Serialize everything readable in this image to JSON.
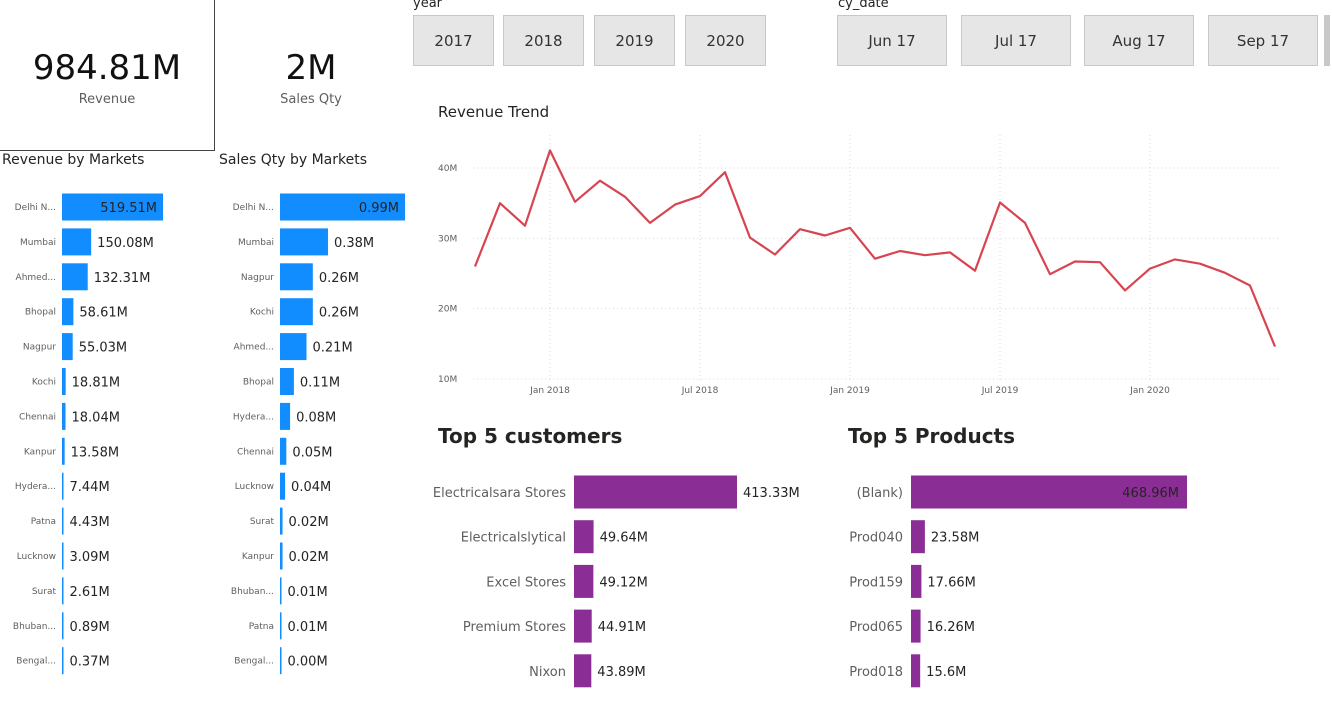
{
  "kpis": {
    "revenue": {
      "value": "984.81M",
      "label": "Revenue"
    },
    "sales_qty": {
      "value": "2M",
      "label": "Sales Qty"
    }
  },
  "slicers": {
    "year": {
      "label": "year",
      "options": [
        "2017",
        "2018",
        "2019",
        "2020"
      ]
    },
    "cy_date": {
      "label": "cy_date",
      "options": [
        "Jun 17",
        "Jul 17",
        "Aug 17",
        "Sep 17"
      ]
    }
  },
  "colors": {
    "blue_bar": "#118dff",
    "purple_bar": "#8a2e96",
    "line": "#d64550",
    "grid": "#d9d9d9"
  },
  "chart_data": [
    {
      "id": "revenue_by_markets",
      "type": "bar",
      "orientation": "horizontal",
      "title": "Revenue by Markets",
      "categories": [
        "Delhi N...",
        "Mumbai",
        "Ahmed...",
        "Bhopal",
        "Nagpur",
        "Kochi",
        "Chennai",
        "Kanpur",
        "Hydera...",
        "Patna",
        "Lucknow",
        "Surat",
        "Bhuban...",
        "Bengal..."
      ],
      "values": [
        519.51,
        150.08,
        132.31,
        58.61,
        55.03,
        18.81,
        18.04,
        13.58,
        7.44,
        4.43,
        3.09,
        2.61,
        0.89,
        0.37
      ],
      "labels": [
        "519.51M",
        "150.08M",
        "132.31M",
        "58.61M",
        "55.03M",
        "18.81M",
        "18.04M",
        "13.58M",
        "7.44M",
        "4.43M",
        "3.09M",
        "2.61M",
        "0.89M",
        "0.37M"
      ],
      "unit": "M",
      "color": "#118dff"
    },
    {
      "id": "sales_qty_by_markets",
      "type": "bar",
      "orientation": "horizontal",
      "title": "Sales Qty by Markets",
      "categories": [
        "Delhi N...",
        "Mumbai",
        "Nagpur",
        "Kochi",
        "Ahmed...",
        "Bhopal",
        "Hydera...",
        "Chennai",
        "Lucknow",
        "Surat",
        "Kanpur",
        "Bhuban...",
        "Patna",
        "Bengal..."
      ],
      "values": [
        0.99,
        0.38,
        0.26,
        0.26,
        0.21,
        0.11,
        0.08,
        0.05,
        0.04,
        0.02,
        0.02,
        0.01,
        0.01,
        0.0
      ],
      "labels": [
        "0.99M",
        "0.38M",
        "0.26M",
        "0.26M",
        "0.21M",
        "0.11M",
        "0.08M",
        "0.05M",
        "0.04M",
        "0.02M",
        "0.02M",
        "0.01M",
        "0.01M",
        "0.00M"
      ],
      "unit": "M",
      "color": "#118dff"
    },
    {
      "id": "revenue_trend",
      "type": "line",
      "title": "Revenue Trend",
      "x": [
        "2017-10",
        "2017-11",
        "2017-12",
        "2018-01",
        "2018-02",
        "2018-03",
        "2018-04",
        "2018-05",
        "2018-06",
        "2018-07",
        "2018-08",
        "2018-09",
        "2018-10",
        "2018-11",
        "2018-12",
        "2019-01",
        "2019-02",
        "2019-03",
        "2019-04",
        "2019-05",
        "2019-06",
        "2019-07",
        "2019-08",
        "2019-09",
        "2019-10",
        "2019-11",
        "2019-12",
        "2020-01",
        "2020-02",
        "2020-03",
        "2020-04",
        "2020-05",
        "2020-06"
      ],
      "values": [
        26.0,
        35.0,
        31.8,
        42.5,
        35.2,
        38.2,
        35.9,
        32.2,
        34.8,
        36.0,
        39.4,
        30.1,
        27.7,
        31.3,
        30.4,
        31.5,
        27.1,
        28.2,
        27.6,
        28.0,
        25.4,
        35.1,
        32.2,
        24.9,
        26.7,
        26.6,
        22.6,
        25.7,
        27.0,
        26.4,
        25.1,
        23.3,
        14.6
      ],
      "x_ticks": [
        "Jan 2018",
        "Jul 2018",
        "Jan 2019",
        "Jul 2019",
        "Jan 2020"
      ],
      "x_tick_dates": [
        "2018-01",
        "2018-07",
        "2019-01",
        "2019-07",
        "2020-01"
      ],
      "y_ticks": [
        "10M",
        "20M",
        "30M",
        "40M"
      ],
      "y_tick_values": [
        10,
        20,
        30,
        40
      ],
      "ylim": [
        10,
        40
      ],
      "unit": "M",
      "grid": true,
      "color": "#d64550"
    },
    {
      "id": "top5_customers",
      "type": "bar",
      "orientation": "horizontal",
      "title": "Top 5 customers",
      "categories": [
        "Electricalsara Stores",
        "Electricalslytical",
        "Excel Stores",
        "Premium Stores",
        "Nixon"
      ],
      "values": [
        413.33,
        49.64,
        49.12,
        44.91,
        43.89
      ],
      "labels": [
        "413.33M",
        "49.64M",
        "49.12M",
        "44.91M",
        "43.89M"
      ],
      "unit": "M",
      "color": "#8a2e96"
    },
    {
      "id": "top5_products",
      "type": "bar",
      "orientation": "horizontal",
      "title": "Top 5 Products",
      "categories": [
        "(Blank)",
        "Prod040",
        "Prod159",
        "Prod065",
        "Prod018"
      ],
      "values": [
        468.96,
        23.58,
        17.66,
        16.26,
        15.6
      ],
      "labels": [
        "468.96M",
        "23.58M",
        "17.66M",
        "16.26M",
        "15.6M"
      ],
      "unit": "M",
      "color": "#8a2e96"
    }
  ]
}
